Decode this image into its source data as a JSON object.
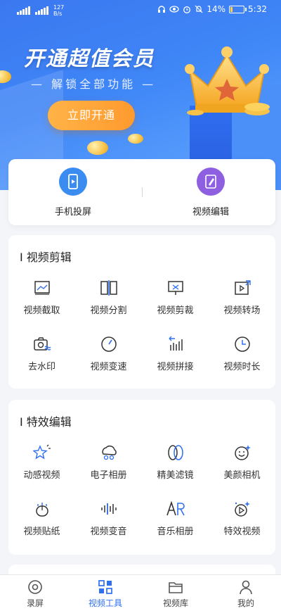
{
  "status_bar": {
    "speed_value": "127",
    "speed_unit": "B/s",
    "battery": "14%",
    "battery_level": 0.14,
    "time": "5:32"
  },
  "banner": {
    "title": "开通超值会员",
    "subtitle": "— 解锁全部功能 —",
    "cta": "立即开通"
  },
  "quick_actions": [
    {
      "label": "手机投屏",
      "icon": "phone-mirror-icon",
      "color": "#3b8cf0"
    },
    {
      "label": "视频编辑",
      "icon": "video-edit-icon",
      "color": "#8e5fe0"
    }
  ],
  "video_editing": {
    "title": "I 视频剪辑",
    "items": [
      {
        "label": "视频截取",
        "icon": "video-trim-icon"
      },
      {
        "label": "视频分割",
        "icon": "video-split-icon"
      },
      {
        "label": "视频剪裁",
        "icon": "video-crop-icon"
      },
      {
        "label": "视频转场",
        "icon": "video-transition-icon"
      },
      {
        "label": "去水印",
        "icon": "remove-watermark-icon"
      },
      {
        "label": "视频变速",
        "icon": "speed-icon"
      },
      {
        "label": "视频拼接",
        "icon": "merge-icon"
      },
      {
        "label": "视频时长",
        "icon": "clock-icon"
      }
    ]
  },
  "effects_editing": {
    "title": "I 特效编辑",
    "items": [
      {
        "label": "动感视频",
        "icon": "sparkle-icon"
      },
      {
        "label": "电子相册",
        "icon": "album-icon"
      },
      {
        "label": "精美滤镜",
        "icon": "filter-icon"
      },
      {
        "label": "美颜相机",
        "icon": "beauty-face-icon"
      },
      {
        "label": "视频贴纸",
        "icon": "sticker-icon"
      },
      {
        "label": "视频变音",
        "icon": "voice-change-icon"
      },
      {
        "label": "音乐相册",
        "icon": "music-album-icon"
      },
      {
        "label": "特效视频",
        "icon": "effects-video-icon"
      }
    ]
  },
  "tab_bar": {
    "items": [
      {
        "label": "录屏",
        "icon": "record-icon"
      },
      {
        "label": "视频工具",
        "icon": "tools-icon",
        "active": true
      },
      {
        "label": "视频库",
        "icon": "folder-icon"
      },
      {
        "label": "我的",
        "icon": "profile-icon"
      }
    ],
    "active_color": "#2f6ff0"
  }
}
